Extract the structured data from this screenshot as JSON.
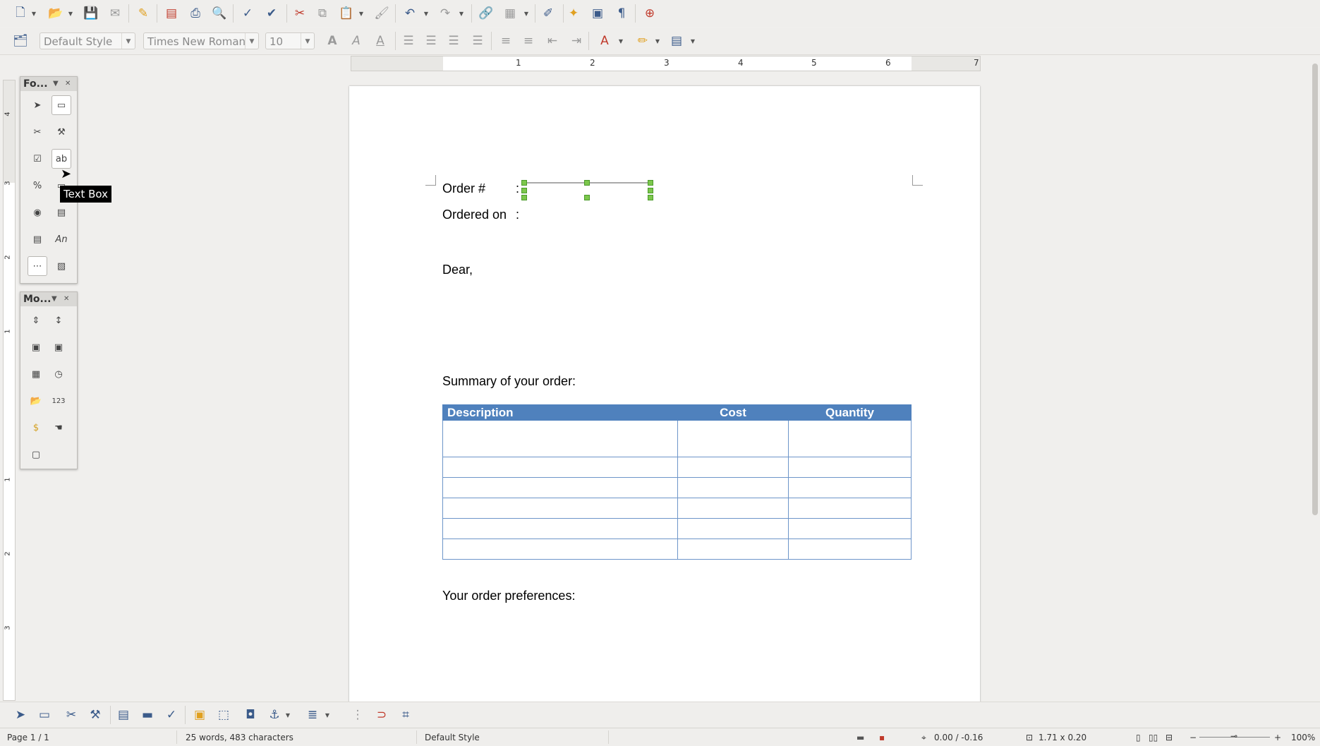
{
  "toolbar_standard": {
    "items": [
      "new",
      "open",
      "save",
      "email",
      "edit-mode",
      "export-pdf",
      "print",
      "print-preview",
      "spellcheck",
      "autospellcheck",
      "cut",
      "copy",
      "paste",
      "clone-format",
      "undo",
      "redo",
      "hyperlink",
      "table",
      "draw-functions",
      "navigator",
      "gallery",
      "formatting-marks",
      "help"
    ]
  },
  "toolbar_formatting": {
    "paragraph_style": "Default Style",
    "font_name": "Times New Roman",
    "font_size": "10"
  },
  "form_controls_panel": {
    "title": "Fo...",
    "tooltip": "Text Box"
  },
  "more_controls_panel": {
    "title": "Mo..."
  },
  "document": {
    "order_label": "Order #",
    "order_colon": ":",
    "ordered_on_label": "Ordered on",
    "ordered_on_colon": ":",
    "greeting": "Dear,",
    "summary_heading": "Summary of your order:",
    "table": {
      "headers": [
        "Description",
        "Cost",
        "Quantity"
      ],
      "rows": [
        [
          "",
          "",
          ""
        ],
        [
          "",
          "",
          ""
        ],
        [
          "",
          "",
          ""
        ],
        [
          "",
          "",
          ""
        ],
        [
          "",
          "",
          ""
        ],
        [
          "",
          "",
          ""
        ]
      ]
    },
    "preferences_heading": "Your order preferences:"
  },
  "rulers": {
    "horizontal_labels": [
      "1",
      "2",
      "3",
      "4",
      "5",
      "6",
      "7"
    ],
    "vertical_labels": [
      "4",
      "3",
      "2",
      "1",
      "1",
      "2",
      "3"
    ]
  },
  "statusbar": {
    "page": "Page 1 / 1",
    "word_count": "25 words, 483 characters",
    "page_style": "Default Style",
    "position": "0.00 / -0.16",
    "size": "1.71 x 0.20",
    "zoom": "100%"
  }
}
